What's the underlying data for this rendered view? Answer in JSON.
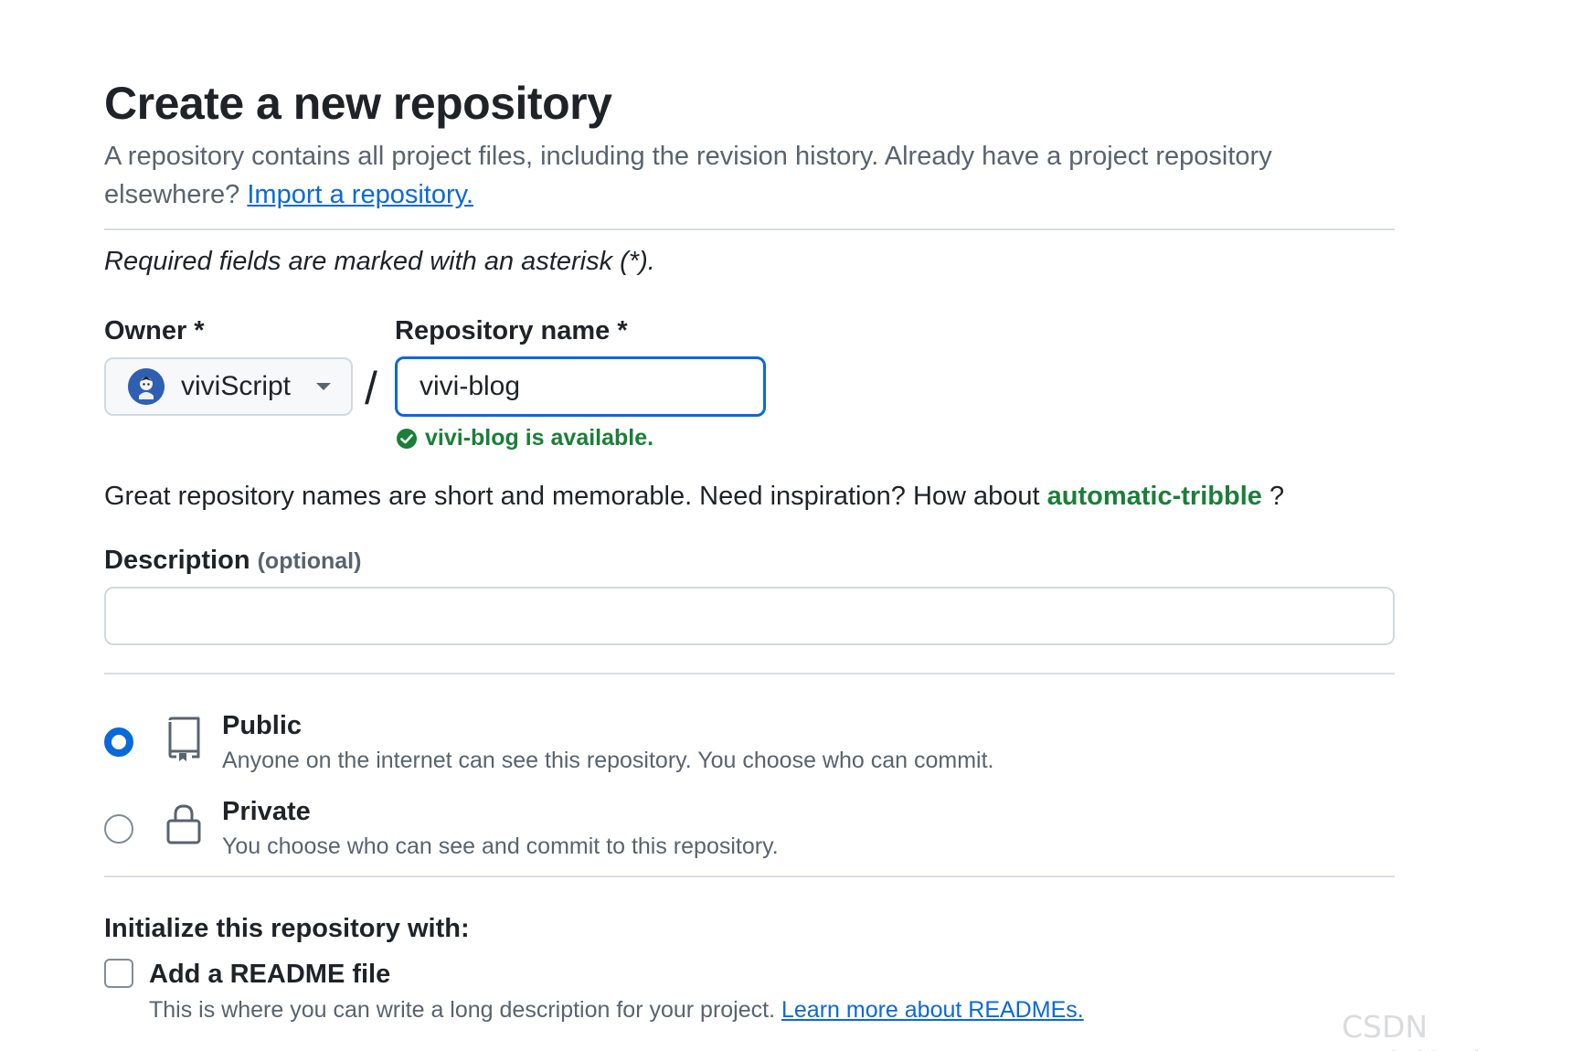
{
  "header": {
    "title": "Create a new repository",
    "subtitle_text": "A repository contains all project files, including the revision history. Already have a project repository elsewhere? ",
    "import_link": "Import a repository."
  },
  "required_note": "Required fields are marked with an asterisk (*).",
  "owner": {
    "label": "Owner *",
    "value": "viviScript",
    "avatar_icon": "user-avatar"
  },
  "separator": "/",
  "repo_name": {
    "label": "Repository name *",
    "value": "vivi-blog",
    "availability": "vivi-blog is available."
  },
  "inspiration": {
    "text": "Great repository names are short and memorable. Need inspiration? How about ",
    "suggestion": "automatic-tribble",
    "suffix": " ?"
  },
  "description": {
    "label": "Description",
    "optional": "(optional)",
    "value": ""
  },
  "visibility": {
    "selected": "public",
    "options": [
      {
        "id": "public",
        "title": "Public",
        "description": "Anyone on the internet can see this repository. You choose who can commit.",
        "icon": "repo-icon"
      },
      {
        "id": "private",
        "title": "Private",
        "description": "You choose who can see and commit to this repository.",
        "icon": "lock-icon"
      }
    ]
  },
  "initialize": {
    "heading": "Initialize this repository with:",
    "readme": {
      "label": "Add a README file",
      "checked": false,
      "description": "This is where you can write a long description for your project. ",
      "link": "Learn more about READMEs."
    }
  },
  "watermark": "CSDN @viviScript",
  "colors": {
    "accent": "#0969da",
    "success": "#1a7f37",
    "muted": "#59636e",
    "border": "#d1d9e0"
  }
}
